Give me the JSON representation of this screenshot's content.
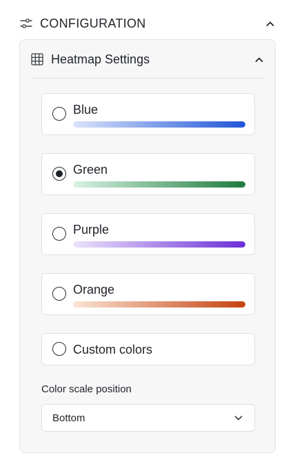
{
  "configuration": {
    "title": "CONFIGURATION",
    "icon": "sliders-icon",
    "toggle_icon": "chevron-up-icon"
  },
  "heatmap_settings": {
    "title": "Heatmap Settings",
    "icon": "grid-icon",
    "toggle_icon": "chevron-up-icon",
    "color_options": [
      {
        "label": "Blue",
        "selected": false,
        "gradient": [
          "#dbe4fb",
          "#1f55d6"
        ]
      },
      {
        "label": "Green",
        "selected": true,
        "gradient": [
          "#d8f3e3",
          "#1d7a3c"
        ]
      },
      {
        "label": "Purple",
        "selected": false,
        "gradient": [
          "#ece4fb",
          "#6b2ed6"
        ]
      },
      {
        "label": "Orange",
        "selected": false,
        "gradient": [
          "#fbe4d4",
          "#c4420f"
        ]
      },
      {
        "label": "Custom colors",
        "selected": false
      }
    ],
    "color_scale_position": {
      "label": "Color scale position",
      "value": "Bottom",
      "icon": "chevron-down-icon"
    }
  }
}
